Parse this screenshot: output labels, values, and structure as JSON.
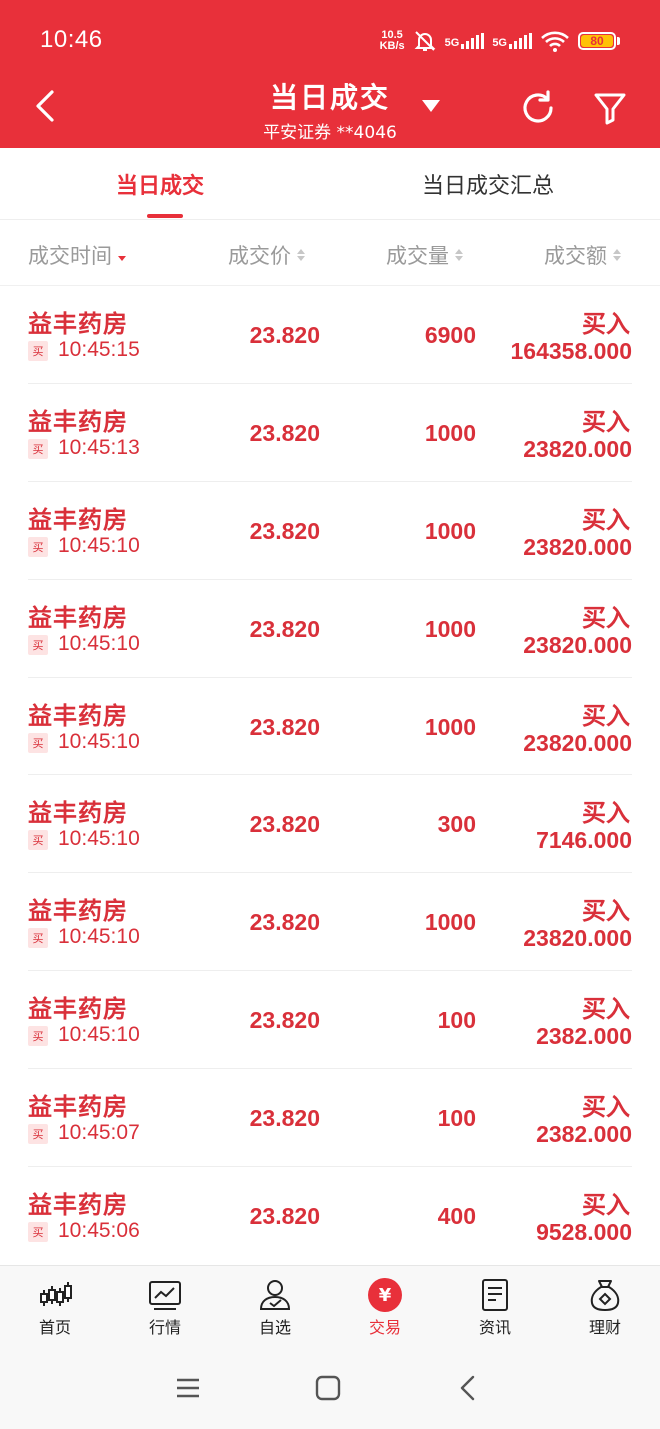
{
  "status_bar": {
    "time": "10:46",
    "net_speed_value": "10.5",
    "net_speed_unit": "KB/s",
    "sim1": "5G",
    "sim2": "5G",
    "battery": "80",
    "icons": [
      "bell-muted-icon",
      "signal-icon",
      "wifi-icon",
      "battery-icon"
    ]
  },
  "header": {
    "title": "当日成交",
    "subtitle": "平安证券 **4046",
    "icons": [
      "back-arrow-icon",
      "dropdown-caret-icon",
      "refresh-icon",
      "filter-icon"
    ]
  },
  "tabs": [
    {
      "label": "当日成交",
      "active": true
    },
    {
      "label": "当日成交汇总",
      "active": false
    }
  ],
  "columns": {
    "time": "成交时间",
    "price": "成交价",
    "qty": "成交量",
    "amount": "成交额"
  },
  "rows": [
    {
      "name": "益丰药房",
      "side": "买",
      "time": "10:45:15",
      "price": "23.820",
      "qty": "6900",
      "action": "买入",
      "amount": "164358.000"
    },
    {
      "name": "益丰药房",
      "side": "买",
      "time": "10:45:13",
      "price": "23.820",
      "qty": "1000",
      "action": "买入",
      "amount": "23820.000"
    },
    {
      "name": "益丰药房",
      "side": "买",
      "time": "10:45:10",
      "price": "23.820",
      "qty": "1000",
      "action": "买入",
      "amount": "23820.000"
    },
    {
      "name": "益丰药房",
      "side": "买",
      "time": "10:45:10",
      "price": "23.820",
      "qty": "1000",
      "action": "买入",
      "amount": "23820.000"
    },
    {
      "name": "益丰药房",
      "side": "买",
      "time": "10:45:10",
      "price": "23.820",
      "qty": "1000",
      "action": "买入",
      "amount": "23820.000"
    },
    {
      "name": "益丰药房",
      "side": "买",
      "time": "10:45:10",
      "price": "23.820",
      "qty": "300",
      "action": "买入",
      "amount": "7146.000"
    },
    {
      "name": "益丰药房",
      "side": "买",
      "time": "10:45:10",
      "price": "23.820",
      "qty": "1000",
      "action": "买入",
      "amount": "23820.000"
    },
    {
      "name": "益丰药房",
      "side": "买",
      "time": "10:45:10",
      "price": "23.820",
      "qty": "100",
      "action": "买入",
      "amount": "2382.000"
    },
    {
      "name": "益丰药房",
      "side": "买",
      "time": "10:45:07",
      "price": "23.820",
      "qty": "100",
      "action": "买入",
      "amount": "2382.000"
    },
    {
      "name": "益丰药房",
      "side": "买",
      "time": "10:45:06",
      "price": "23.820",
      "qty": "400",
      "action": "买入",
      "amount": "9528.000"
    }
  ],
  "bottom_nav": [
    {
      "label": "首页",
      "icon": "candlestick-icon",
      "active": false
    },
    {
      "label": "行情",
      "icon": "chart-icon",
      "active": false
    },
    {
      "label": "自选",
      "icon": "user-check-icon",
      "active": false
    },
    {
      "label": "交易",
      "icon": "yen-icon",
      "active": true,
      "glyph": "¥"
    },
    {
      "label": "资讯",
      "icon": "document-icon",
      "active": false
    },
    {
      "label": "理财",
      "icon": "money-bag-icon",
      "active": false
    }
  ],
  "colors": {
    "brand_red": "#e8303a",
    "text_red": "#d9303a",
    "muted_gray": "#9a9a9a"
  }
}
